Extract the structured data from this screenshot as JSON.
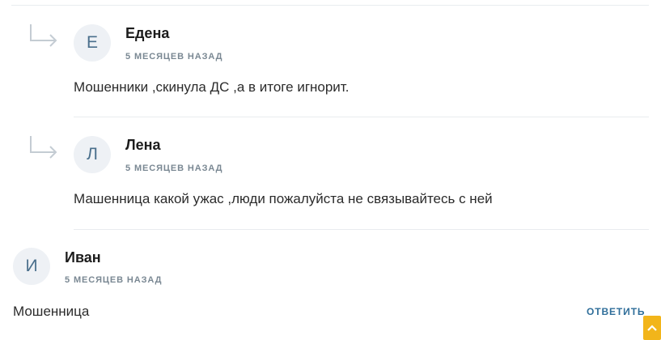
{
  "comments": [
    {
      "avatar_letter": "Е",
      "author": "Едена",
      "time": "5 МЕСЯЦЕВ НАЗАД",
      "text": "Мошенники ,скинула ДС ,а в итоге игнорит.",
      "is_reply": true
    },
    {
      "avatar_letter": "Л",
      "author": "Лена",
      "time": "5 МЕСЯЦЕВ НАЗАД",
      "text": "Машенница какой ужас ,люди пожалуйста не связывайтесь с ней",
      "is_reply": true
    },
    {
      "avatar_letter": "И",
      "author": "Иван",
      "time": "5 МЕСЯЦЕВ НАЗАД",
      "text": "Мошенница",
      "is_reply": false,
      "reply_label": "ОТВЕТИТЬ"
    }
  ],
  "colors": {
    "accent": "#2f6e9a",
    "avatar_bg": "#eef1f5",
    "avatar_fg": "#4a6f8c",
    "scroll_button": "#f2b51a"
  },
  "icons": {
    "reply_arrow": "reply-arrow-icon",
    "scroll_top": "chevron-up-icon"
  }
}
